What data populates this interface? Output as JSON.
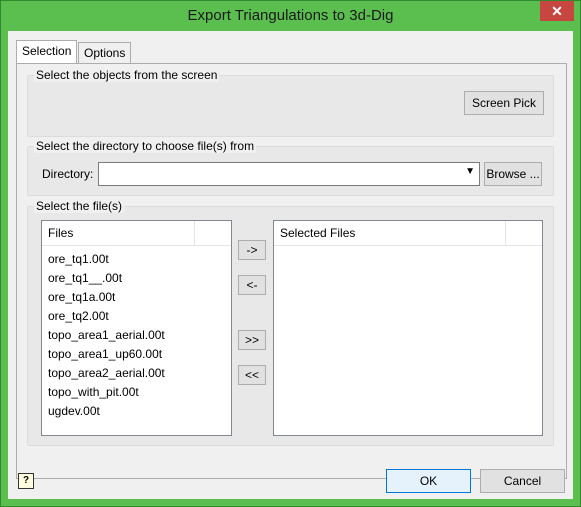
{
  "window": {
    "title": "Export Triangulations to 3d-Dig",
    "close_glyph": "✕"
  },
  "tabs": [
    {
      "label": "Selection"
    },
    {
      "label": "Options"
    }
  ],
  "screen_group": {
    "label": "Select the objects from the screen",
    "screen_pick_label": "Screen Pick"
  },
  "directory_group": {
    "label": "Select the directory to choose file(s) from",
    "directory_label": "Directory:",
    "directory_value": "",
    "browse_label": "Browse ..."
  },
  "files_group": {
    "label": "Select the file(s)",
    "files_header": "Files",
    "selected_header": "Selected Files",
    "files": [
      "ore_tq1.00t",
      "ore_tq1__.00t",
      "ore_tq1a.00t",
      "ore_tq2.00t",
      "topo_area1_aerial.00t",
      "topo_area1_up60.00t",
      "topo_area2_aerial.00t",
      "topo_with_pit.00t",
      "ugdev.00t"
    ],
    "move_right_label": "->",
    "move_left_label": "<-",
    "move_all_right_label": ">>",
    "move_all_left_label": "<<"
  },
  "footer": {
    "help_glyph": "?",
    "ok_label": "OK",
    "cancel_label": "Cancel"
  }
}
